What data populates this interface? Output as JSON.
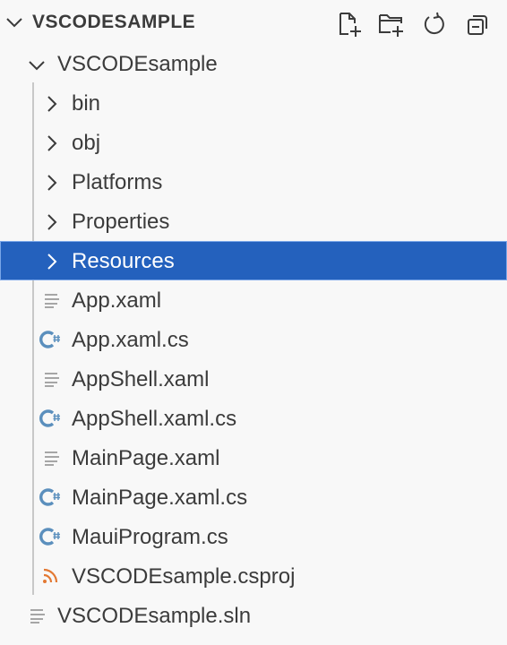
{
  "explorer": {
    "section_title": "VSCODESAMPLE",
    "actions": [
      {
        "name": "new-file-icon"
      },
      {
        "name": "new-folder-icon"
      },
      {
        "name": "refresh-icon"
      },
      {
        "name": "collapse-all-icon"
      }
    ]
  },
  "tree": {
    "project_folder": "VSCODEsample",
    "items": [
      {
        "label": "bin",
        "type": "folder"
      },
      {
        "label": "obj",
        "type": "folder"
      },
      {
        "label": "Platforms",
        "type": "folder"
      },
      {
        "label": "Properties",
        "type": "folder"
      },
      {
        "label": "Resources",
        "type": "folder",
        "selected": true
      },
      {
        "label": "App.xaml",
        "type": "text-file"
      },
      {
        "label": "App.xaml.cs",
        "type": "csharp-file"
      },
      {
        "label": "AppShell.xaml",
        "type": "text-file"
      },
      {
        "label": "AppShell.xaml.cs",
        "type": "csharp-file"
      },
      {
        "label": "MainPage.xaml",
        "type": "text-file"
      },
      {
        "label": "MainPage.xaml.cs",
        "type": "csharp-file"
      },
      {
        "label": "MauiProgram.cs",
        "type": "csharp-file"
      },
      {
        "label": "VSCODEsample.csproj",
        "type": "rss-file"
      }
    ],
    "solution_file": "VSCODEsample.sln"
  },
  "colors": {
    "selection_bg": "#2461bd",
    "csharp_icon": "#5b8fbd",
    "csproj_icon": "#e37933",
    "text": "#3b3b3b"
  }
}
